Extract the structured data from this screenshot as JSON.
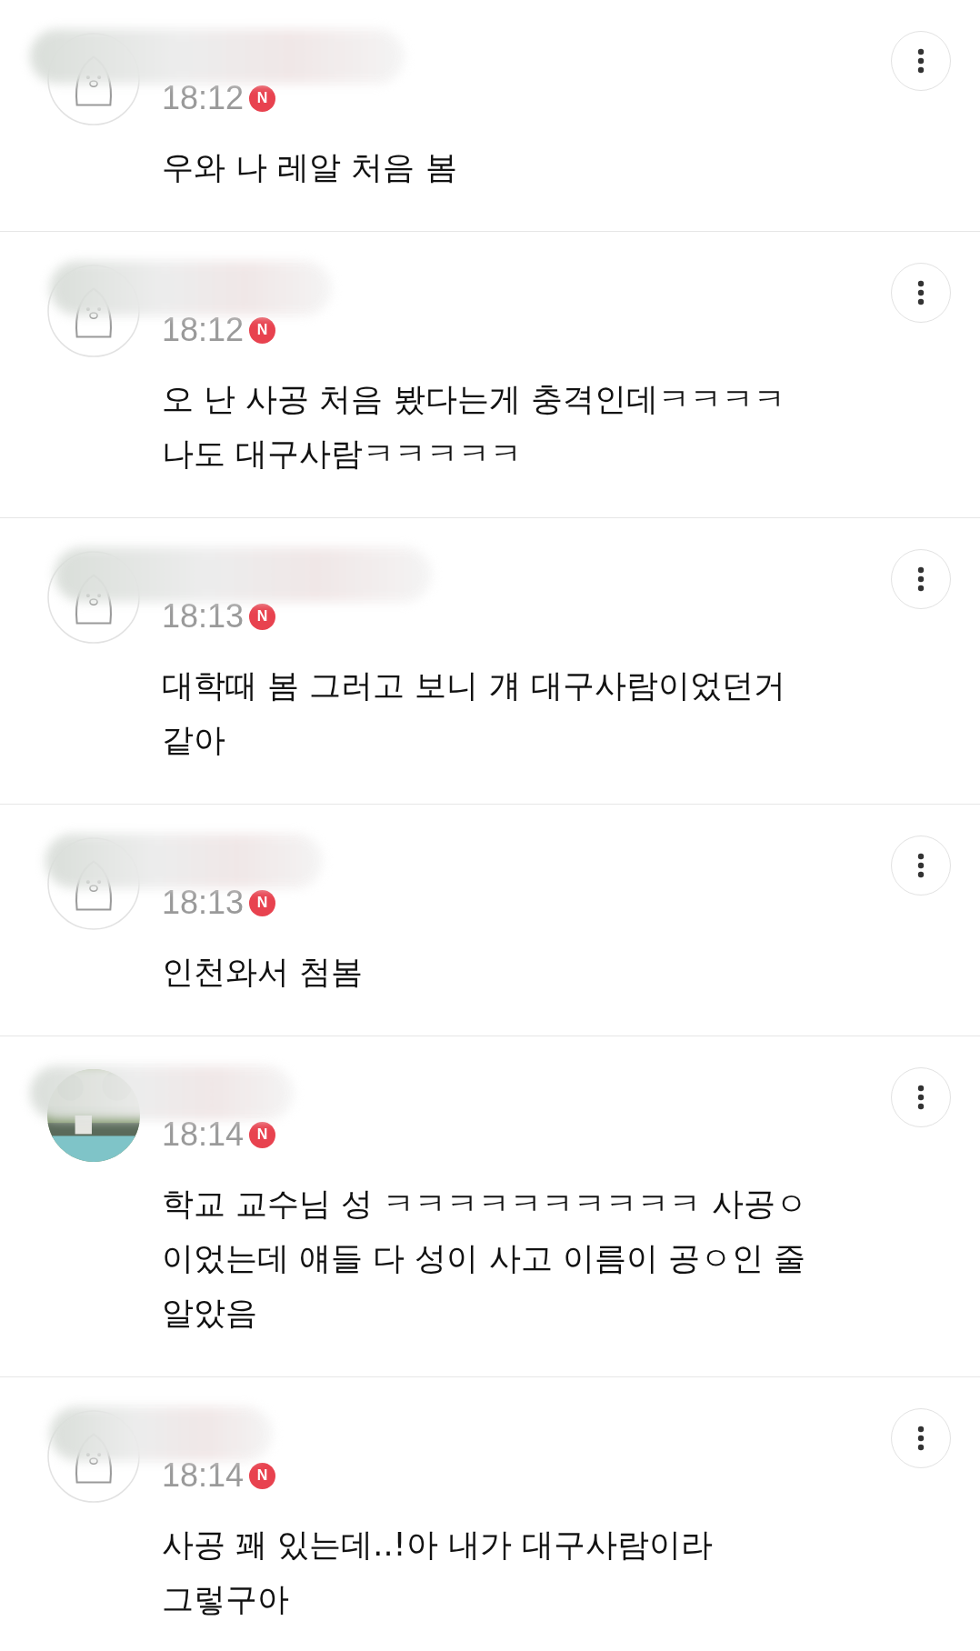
{
  "comments": [
    {
      "avatar": {
        "kind": "character"
      },
      "time": "18:12",
      "badge": "N",
      "text": "우와 나 레알 처음 봄"
    },
    {
      "avatar": {
        "kind": "character"
      },
      "time": "18:12",
      "badge": "N",
      "text": "오 난 사공 처음 봤다는게 충격인데ㅋㅋㅋㅋ\n나도 대구사람ㅋㅋㅋㅋㅋ"
    },
    {
      "avatar": {
        "kind": "character"
      },
      "time": "18:13",
      "badge": "N",
      "text": "대학때 봄 그러고 보니 걔 대구사람이었던거\n같아"
    },
    {
      "avatar": {
        "kind": "character"
      },
      "time": "18:13",
      "badge": "N",
      "text": "인천와서 첨봄"
    },
    {
      "time": "18:14",
      "badge": "N",
      "text": "학교 교수님 성 ㅋㅋㅋㅋㅋㅋㅋㅋㅋㅋ 사공ㅇ\n이었는데 얘들 다 성이 사고 이름이 공ㅇ인 줄\n알았음"
    },
    {
      "avatar": {
        "kind": "character"
      },
      "time": "18:14",
      "badge": "N",
      "text": "사공 꽤 있는데..!아 내가 대구사람이라\n그렇구아"
    }
  ]
}
